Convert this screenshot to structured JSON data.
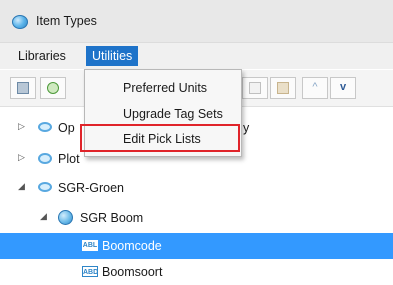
{
  "window": {
    "title": "Item Types",
    "icon": "item-types-icon"
  },
  "menubar": {
    "items": [
      "Libraries",
      "Utilities"
    ],
    "active": "Utilities"
  },
  "toolbar": {
    "buttons": [
      "save-icon",
      "add-item-icon",
      "copy-icon",
      "paste-icon",
      "move-up-icon",
      "move-down-icon"
    ],
    "up_glyph": "^",
    "down_glyph": "v"
  },
  "utilities_menu": {
    "items": [
      {
        "label": "Preferred Units"
      },
      {
        "label": "Upgrade Tag Sets"
      },
      {
        "label": "Edit Pick Lists",
        "highlighted": true
      }
    ]
  },
  "tree": {
    "rows": [
      {
        "label": "Op",
        "tail": "y",
        "expanded": false,
        "icon": "library-icon"
      },
      {
        "label": "Plot",
        "expanded": false,
        "icon": "library-check-icon"
      },
      {
        "label": "SGR-Groen",
        "expanded": true,
        "icon": "library-icon"
      },
      {
        "label": "SGR Boom",
        "expanded": true,
        "icon": "item-type-icon"
      },
      {
        "label": "Boomcode",
        "selected": true,
        "icon": "field-icon",
        "icon_text": "ABL"
      },
      {
        "label": "Boomsoort",
        "icon": "field-icon",
        "icon_text": "ABD"
      }
    ]
  },
  "colors": {
    "accent": "#1e73c9",
    "selection": "#3399ff",
    "callout": "#e0242a"
  }
}
